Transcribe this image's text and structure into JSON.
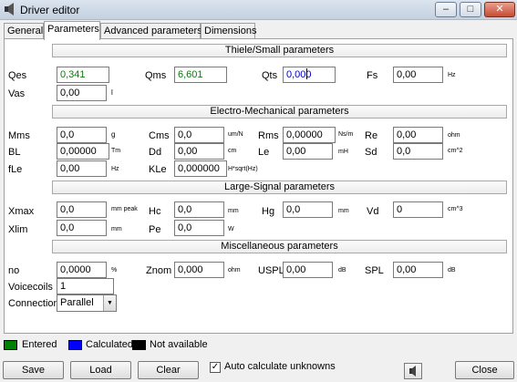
{
  "window": {
    "title": "Driver editor",
    "minimize": "–",
    "maximize": "□",
    "close": "✕"
  },
  "tabs": [
    "General",
    "Parameters",
    "Advanced parameters",
    "Dimensions"
  ],
  "sections": {
    "ts": "Thiele/Small parameters",
    "em": "Electro-Mechanical parameters",
    "ls": "Large-Signal parameters",
    "misc": "Miscellaneous parameters"
  },
  "ts": {
    "qes": {
      "label": "Qes",
      "value": "0,341"
    },
    "qms": {
      "label": "Qms",
      "value": "6,601"
    },
    "qts": {
      "label": "Qts",
      "value": "0,000"
    },
    "fs": {
      "label": "Fs",
      "value": "0,00",
      "unit": "Hz"
    },
    "vas": {
      "label": "Vas",
      "value": "0,00",
      "unit": "l"
    }
  },
  "em": {
    "mms": {
      "label": "Mms",
      "value": "0,0",
      "unit": "g"
    },
    "cms": {
      "label": "Cms",
      "value": "0,0",
      "unit": "um/N"
    },
    "rms": {
      "label": "Rms",
      "value": "0,00000",
      "unit": "Ns/m"
    },
    "re": {
      "label": "Re",
      "value": "0,00",
      "unit": "ohm"
    },
    "bl": {
      "label": "BL",
      "value": "0,00000",
      "unit": "Tm"
    },
    "dd": {
      "label": "Dd",
      "value": "0,00",
      "unit": "cm"
    },
    "le": {
      "label": "Le",
      "value": "0,00",
      "unit": "mH"
    },
    "sd": {
      "label": "Sd",
      "value": "0,0",
      "unit": "cm^2"
    },
    "fle": {
      "label": "fLe",
      "value": "0,00",
      "unit": "Hz"
    },
    "kle": {
      "label": "KLe",
      "value": "0,000000",
      "unit": "H*sqrt(Hz)"
    }
  },
  "ls": {
    "xmax": {
      "label": "Xmax",
      "value": "0,0",
      "unit": "mm peak"
    },
    "hc": {
      "label": "Hc",
      "value": "0,0",
      "unit": "mm"
    },
    "hg": {
      "label": "Hg",
      "value": "0,0",
      "unit": "mm"
    },
    "vd": {
      "label": "Vd",
      "value": "0",
      "unit": "cm^3"
    },
    "xlim": {
      "label": "Xlim",
      "value": "0,0",
      "unit": "mm"
    },
    "pe": {
      "label": "Pe",
      "value": "0,0",
      "unit": "W"
    }
  },
  "misc": {
    "no": {
      "label": "no",
      "value": "0,0000",
      "unit": "%"
    },
    "znom": {
      "label": "Znom",
      "value": "0,000",
      "unit": "ohm"
    },
    "uspl": {
      "label": "USPL",
      "value": "0,00",
      "unit": "dB"
    },
    "spl": {
      "label": "SPL",
      "value": "0,00",
      "unit": "dB"
    },
    "voicecoils": {
      "label": "Voicecoils",
      "value": "1"
    },
    "connection": {
      "label": "Connection",
      "value": "Parallel"
    }
  },
  "legend": {
    "entered": {
      "label": "Entered",
      "color": "#008000"
    },
    "calculated": {
      "label": "Calculated",
      "color": "#0000ff"
    },
    "unavailable": {
      "label": "Not available",
      "color": "#000000"
    }
  },
  "buttons": {
    "save": "Save",
    "load": "Load",
    "clear": "Clear",
    "close": "Close"
  },
  "auto_calc": {
    "label": "Auto calculate unknowns",
    "checked": true,
    "mark": "✓"
  },
  "icons": {
    "app": "speaker-icon",
    "speaker_button": "speaker-icon"
  }
}
